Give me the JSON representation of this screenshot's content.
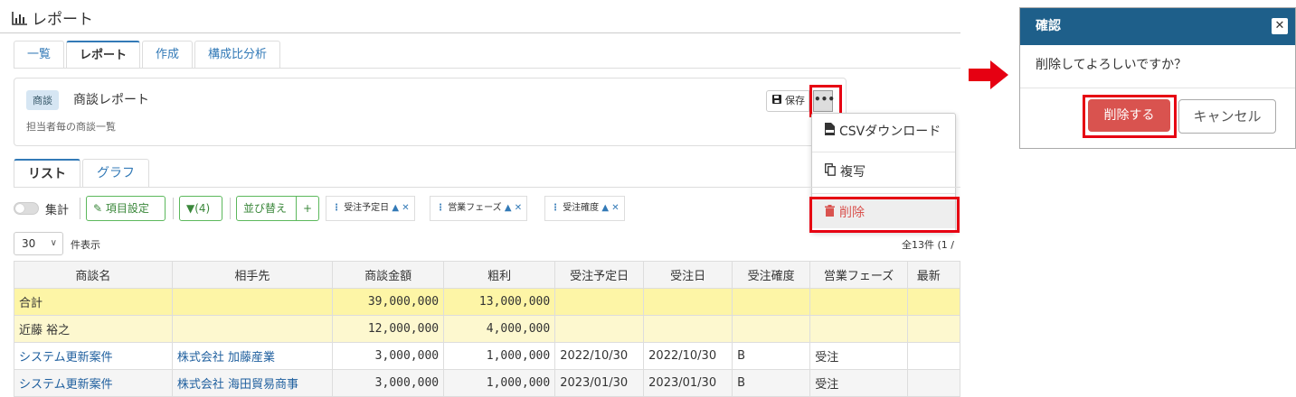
{
  "page": {
    "title": "レポート",
    "icon": "bar-chart-icon"
  },
  "top_tabs": [
    {
      "label": "一覧",
      "active": false
    },
    {
      "label": "レポート",
      "active": true
    },
    {
      "label": "作成",
      "active": false
    },
    {
      "label": "構成比分析",
      "active": false
    }
  ],
  "report": {
    "badge": "商談",
    "name": "商談レポート",
    "description": "担当者毎の商談一覧",
    "save_label": "保存",
    "more_label": "•••"
  },
  "menu": {
    "csv": "CSVダウンロード",
    "copy": "複写",
    "delete": "削除"
  },
  "sub_tabs": [
    {
      "label": "リスト",
      "active": true
    },
    {
      "label": "グラフ",
      "active": false
    }
  ],
  "toolbar": {
    "aggregate_label": "集計",
    "columns_label": "項目設定",
    "filter_label": "(4)",
    "sort_label": "並び替え",
    "add_label": "+",
    "sort_chips": [
      {
        "label": "受注予定日",
        "arrow": "▲",
        "remove": "✕"
      },
      {
        "label": "営業フェーズ",
        "arrow": "▲",
        "remove": "✕"
      },
      {
        "label": "受注確度",
        "arrow": "▲",
        "remove": "✕"
      }
    ]
  },
  "pager": {
    "per_page": "30",
    "per_page_label": "件表示",
    "count_text": "全13件 (1 /"
  },
  "table": {
    "columns": [
      "商談名",
      "相手先",
      "商談金額",
      "粗利",
      "受注予定日",
      "受注日",
      "受注確度",
      "営業フェーズ",
      "最新"
    ],
    "total_row": {
      "label": "合計",
      "amount": "39,000,000",
      "profit": "13,000,000"
    },
    "subtotal_row": {
      "label": "近藤 裕之",
      "amount": "12,000,000",
      "profit": "4,000,000"
    },
    "rows": [
      {
        "name": "システム更新案件",
        "client": "株式会社 加藤産業",
        "amount": "3,000,000",
        "profit": "1,000,000",
        "planned": "2022/10/30",
        "ordered": "2022/10/30",
        "certainty": "B",
        "phase": "受注"
      },
      {
        "name": "システム更新案件",
        "client": "株式会社 海田貿易商事",
        "amount": "3,000,000",
        "profit": "1,000,000",
        "planned": "2023/01/30",
        "ordered": "2023/01/30",
        "certainty": "B",
        "phase": "受注"
      }
    ]
  },
  "dialog": {
    "title": "確認",
    "close": "✕",
    "message": "削除してよろしいですか？",
    "delete_label": "削除する",
    "cancel_label": "キャンセル"
  },
  "colors": {
    "highlight": "#e60012",
    "header": "#1e5f8a",
    "danger": "#d9534f",
    "link": "#337ab7",
    "success": "#5cb85c"
  }
}
